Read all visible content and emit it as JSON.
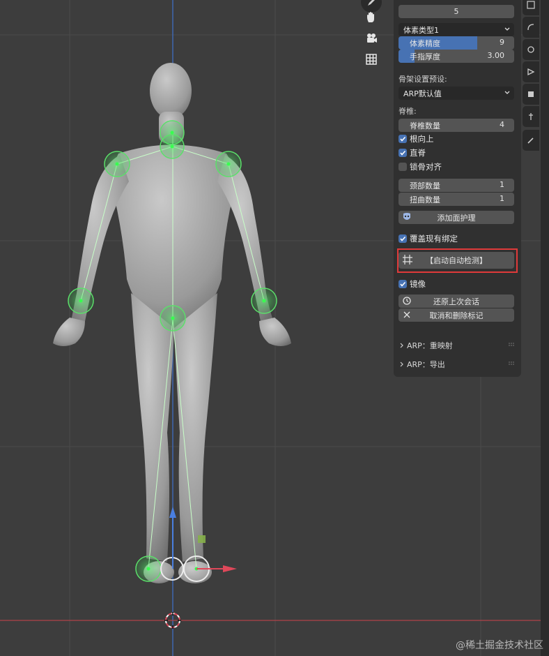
{
  "viewport": {
    "gizmo_icons": [
      "hand-pan-icon",
      "camera-icon",
      "grid-ortho-icon"
    ]
  },
  "panel": {
    "top_value": "5",
    "voxel_type": "体素类型1",
    "voxel_precision": {
      "label": "体素精度",
      "value": "9",
      "fill": 0.68
    },
    "finger_thickness": {
      "label": "手指厚度",
      "value": "3.00",
      "fill": 0.14
    },
    "rig_preset_label": "骨架设置预设:",
    "rig_preset_value": "ARP默认值",
    "spine_label": "脊椎:",
    "spine_count": {
      "label": "脊椎数量",
      "value": "4"
    },
    "root_up": {
      "label": "根向上",
      "checked": true
    },
    "straight_spine": {
      "label": "直脊",
      "checked": true
    },
    "clavicle_align": {
      "label": "锁骨对齐",
      "checked": false
    },
    "neck_count": {
      "label": "颈部数量",
      "value": "1"
    },
    "twist_count": {
      "label": "扭曲数量",
      "value": "1"
    },
    "add_face_rig": "添加面护理",
    "overwrite_binding": {
      "label": "覆盖现有绑定",
      "checked": true
    },
    "auto_detect": "【启动自动检测】",
    "mirror": {
      "label": "镜像",
      "checked": true
    },
    "restore_session": "还原上次会话",
    "cancel_delete": "取消和删除标记",
    "subpanels": [
      "ARP：重映射",
      "ARP：导出"
    ]
  },
  "colors": {
    "accent": "#4772b3",
    "highlight": "#e03a3a",
    "marker": "#3fd45a"
  },
  "watermark": "@稀土掘金技术社区"
}
